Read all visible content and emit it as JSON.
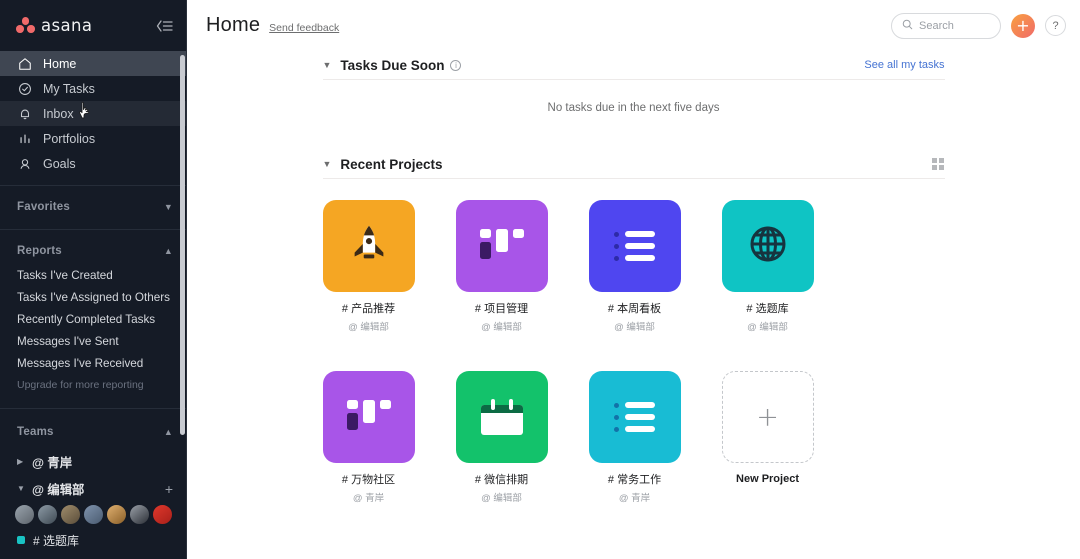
{
  "sidebar": {
    "logo_text": "asana",
    "collapse_icon": "collapse-sidebar-icon",
    "nav": [
      {
        "label": "Home",
        "icon": "home-icon",
        "state": "active"
      },
      {
        "label": "My Tasks",
        "icon": "check-circle-icon",
        "state": "normal"
      },
      {
        "label": "Inbox",
        "icon": "bell-icon",
        "state": "hover"
      },
      {
        "label": "Portfolios",
        "icon": "bar-chart-icon",
        "state": "normal"
      },
      {
        "label": "Goals",
        "icon": "target-person-icon",
        "state": "normal"
      }
    ],
    "favorites": {
      "label": "Favorites",
      "chevron": "chevron-down-icon"
    },
    "reports": {
      "label": "Reports",
      "chevron": "chevron-up-icon",
      "links": [
        "Tasks I've Created",
        "Tasks I've Assigned to Others",
        "Recently Completed Tasks",
        "Messages I've Sent",
        "Messages I've Received"
      ],
      "upgrade": "Upgrade for more reporting"
    },
    "teams": {
      "label": "Teams",
      "chevron": "chevron-up-icon",
      "items": [
        {
          "name": "@ 青岸",
          "expanded": false,
          "triangle": "triangle-right-icon"
        },
        {
          "name": "@ 编辑部",
          "expanded": true,
          "triangle": "triangle-down-icon",
          "add": "+"
        }
      ],
      "avatars": [
        "#8a9097",
        "#5c6670",
        "#7a6a52",
        "#6e7f96",
        "#c58a3e",
        "#4b4f57",
        "#c8372d"
      ],
      "project": {
        "name": "# 选题库",
        "color": "#19c3c3"
      }
    }
  },
  "header": {
    "title": "Home",
    "feedback": "Send feedback",
    "search": {
      "placeholder": "Search",
      "icon": "search-icon"
    },
    "create_button": {
      "label": "+",
      "icon": "plus-icon",
      "color": "#f06a6a"
    },
    "help_button": {
      "label": "?",
      "icon": "question-mark-icon"
    }
  },
  "tasks_due_soon": {
    "title": "Tasks Due Soon",
    "info_icon": "info-icon",
    "caret": "caret-down-icon",
    "see_all": "See all my tasks",
    "empty_message": "No tasks due in the next five days"
  },
  "recent_projects": {
    "title": "Recent Projects",
    "caret": "caret-down-icon",
    "grid_icon": "grid-view-icon",
    "new_project": {
      "label": "New Project",
      "plus": "+"
    },
    "projects": [
      {
        "name": "# 产品推荐",
        "team": "@ 编辑部",
        "color": "#f5a623",
        "icon": "rocket-icon"
      },
      {
        "name": "# 项目管理",
        "team": "@ 编辑部",
        "color": "#a855e8",
        "icon": "board-icon"
      },
      {
        "name": "# 本周看板",
        "team": "@ 编辑部",
        "color": "#4f46f0",
        "icon": "list-icon",
        "dot": "#2d2aa8"
      },
      {
        "name": "# 选题库",
        "team": "@ 编辑部",
        "color": "#0fc4c4",
        "icon": "globe-icon"
      },
      {
        "name": "# 万物社区",
        "team": "@ 青岸",
        "color": "#a855e8",
        "icon": "board-icon"
      },
      {
        "name": "# 微信排期",
        "team": "@ 编辑部",
        "color": "#13c26b",
        "icon": "calendar-icon"
      },
      {
        "name": "# 常务工作",
        "team": "@ 青岸",
        "color": "#18bcd4",
        "icon": "list-icon",
        "dot": "#1272a8"
      }
    ]
  }
}
